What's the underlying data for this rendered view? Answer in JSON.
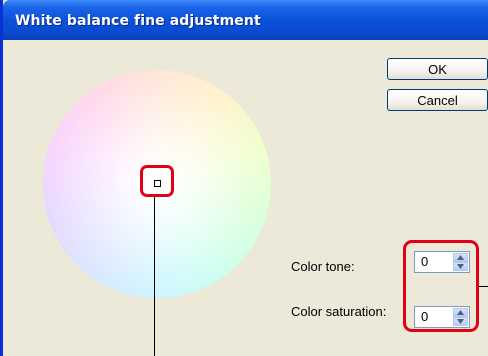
{
  "window": {
    "title": "White balance fine adjustment"
  },
  "buttons": {
    "ok_label": "OK",
    "cancel_label": "Cancel"
  },
  "fields": {
    "color_tone_label": "Color tone:",
    "color_tone_value": "0",
    "color_saturation_label": "Color saturation:",
    "color_saturation_value": "0"
  },
  "colors": {
    "titlebar": "#0a52d8",
    "dialog_background": "#ece9d8",
    "highlight": "#e10015"
  },
  "icons": {
    "spin_up": "triangle-up",
    "spin_down": "triangle-down"
  }
}
